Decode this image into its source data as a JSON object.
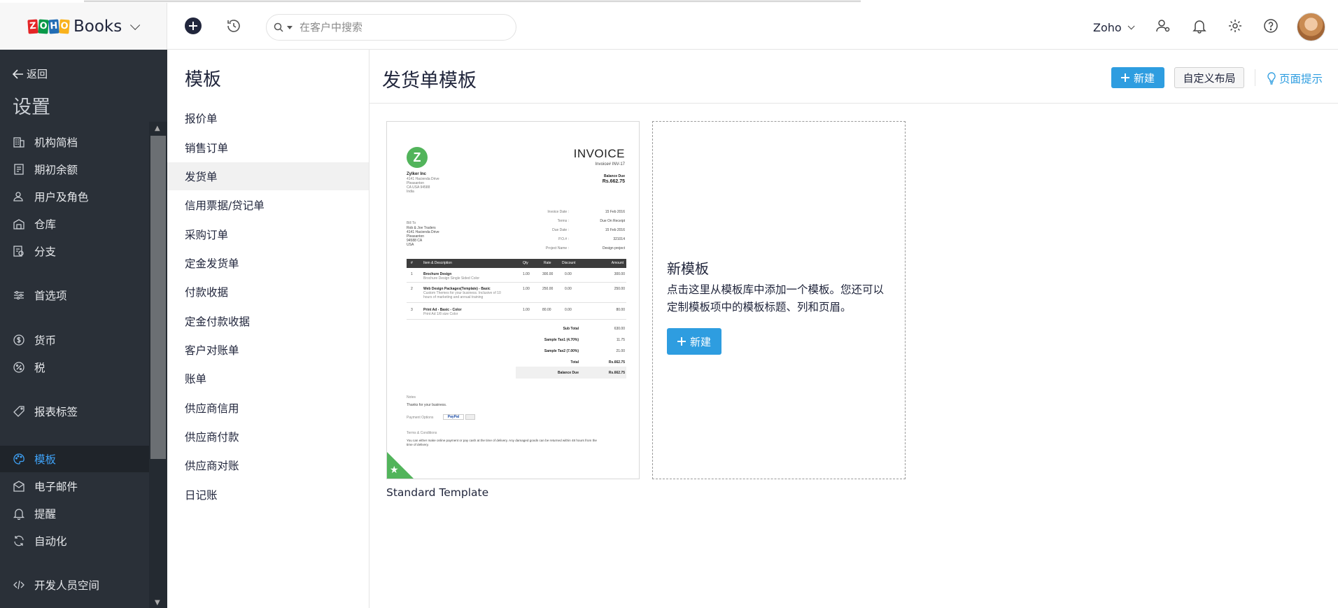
{
  "app": {
    "brand": "Books",
    "logo_letters": [
      "Z",
      "O",
      "H",
      "O"
    ],
    "search_placeholder": "在客户中搜索",
    "org_name": "Zoho"
  },
  "sidebar": {
    "back_label": "返回",
    "title": "设置",
    "items": [
      {
        "label": "机构简档",
        "icon": "building-icon"
      },
      {
        "label": "期初余额",
        "icon": "ledger-icon"
      },
      {
        "label": "用户及角色",
        "icon": "users-icon"
      },
      {
        "label": "仓库",
        "icon": "warehouse-icon"
      },
      {
        "label": "分支",
        "icon": "branch-icon"
      },
      {
        "label": "首选项",
        "icon": "sliders-icon"
      },
      {
        "label": "货币",
        "icon": "currency-icon"
      },
      {
        "label": "税",
        "icon": "tax-icon"
      },
      {
        "label": "报表标签",
        "icon": "tag-icon"
      },
      {
        "label": "模板",
        "icon": "palette-icon",
        "active": true
      },
      {
        "label": "电子邮件",
        "icon": "mail-icon"
      },
      {
        "label": "提醒",
        "icon": "bell-icon"
      },
      {
        "label": "自动化",
        "icon": "refresh-icon"
      },
      {
        "label": "开发人员空间",
        "icon": "code-icon"
      }
    ]
  },
  "submenu": {
    "title": "模板",
    "items": [
      "报价单",
      "销售订单",
      "发货单",
      "信用票据/贷记单",
      "采购订单",
      "定金发货单",
      "付款收据",
      "定金付款收据",
      "客户对账单",
      "账单",
      "供应商信用",
      "供应商付款",
      "供应商对账",
      "日记账"
    ],
    "active_index": 2
  },
  "main": {
    "title": "发货单模板",
    "new_button": "新建",
    "custom_layout_button": "自定义布局",
    "page_tips": "页面提示",
    "template_name": "Standard Template",
    "new_template": {
      "title": "新模板",
      "description": "点击这里从模板库中添加一个模板。您还可以定制模板项中的模板标题、列和页眉。",
      "button": "新建"
    }
  },
  "invoice_preview": {
    "logo_letter": "Z",
    "title": "INVOICE",
    "invoice_no": "Invoice# INV-17",
    "balance_due_label": "Balance Due",
    "balance_due": "Rs.662.75",
    "company": "Zylker Inc",
    "company_addr": [
      "4141 Hacienda Drive",
      "Pleasanton",
      "CA USA 94588",
      "India"
    ],
    "meta": [
      {
        "k": "Invoice Date :",
        "v": "15 Feb 2016"
      },
      {
        "k": "Terms :",
        "v": "Due On Receipt"
      },
      {
        "k": "Due Date :",
        "v": "15 Feb 2016"
      },
      {
        "k": "P.O.# :",
        "v": "321014"
      },
      {
        "k": "Project Name :",
        "v": "Design project"
      }
    ],
    "bill_to_label": "Bill To",
    "bill_to": [
      "Rob & Joe Traders",
      "4141 Hacienda Drive",
      "Pleasanton",
      "94588 CA",
      "USA"
    ],
    "headers": {
      "num": "#",
      "item": "Item & Description",
      "qty": "Qty",
      "rate": "Rate",
      "discount": "Discount",
      "amount": "Amount"
    },
    "rows": [
      {
        "n": "1",
        "item": "Brochure Design",
        "desc": "Brochure Design Single Sided Color",
        "qty": "1.00",
        "rate": "300.00",
        "disc": "0.00",
        "amt": "300.00"
      },
      {
        "n": "2",
        "item": "Web Design Packages(Template) - Basic",
        "desc": "Custom Themes for your business. Inclusive of 10",
        "desc2": "hours of marketing and annual training",
        "qty": "1.00",
        "rate": "250.00",
        "disc": "0.00",
        "amt": "250.00"
      },
      {
        "n": "3",
        "item": "Print Ad - Basic - Color",
        "desc": "Print Ad 1/8 size Color",
        "qty": "1.00",
        "rate": "80.00",
        "disc": "0.00",
        "amt": "80.00"
      }
    ],
    "totals": [
      {
        "k": "Sub Total",
        "v": "630.00"
      },
      {
        "k": "Sample Tax1 (4.70%)",
        "v": "11.75"
      },
      {
        "k": "Sample Tax2 (7.00%)",
        "v": "21.00"
      },
      {
        "k": "Total",
        "v": "Rs.662.75"
      },
      {
        "k": "Balance Due",
        "v": "Rs.662.75"
      }
    ],
    "notes_label": "Notes",
    "notes": "Thanks for your business.",
    "payment_label": "Payment Options",
    "paypal": "PayPal",
    "terms_label": "Terms & Conditions",
    "terms_1": "You can either make online payment or pay cash at the time of delivery. Any damaged goods can be returned within 48 hours from the",
    "terms_2": "time of delivery."
  },
  "colors": {
    "sidebar_bg": "#2a3038",
    "accent": "#2e9de0",
    "active_link": "#3fa2f7",
    "logo_green": "#52b45b"
  }
}
